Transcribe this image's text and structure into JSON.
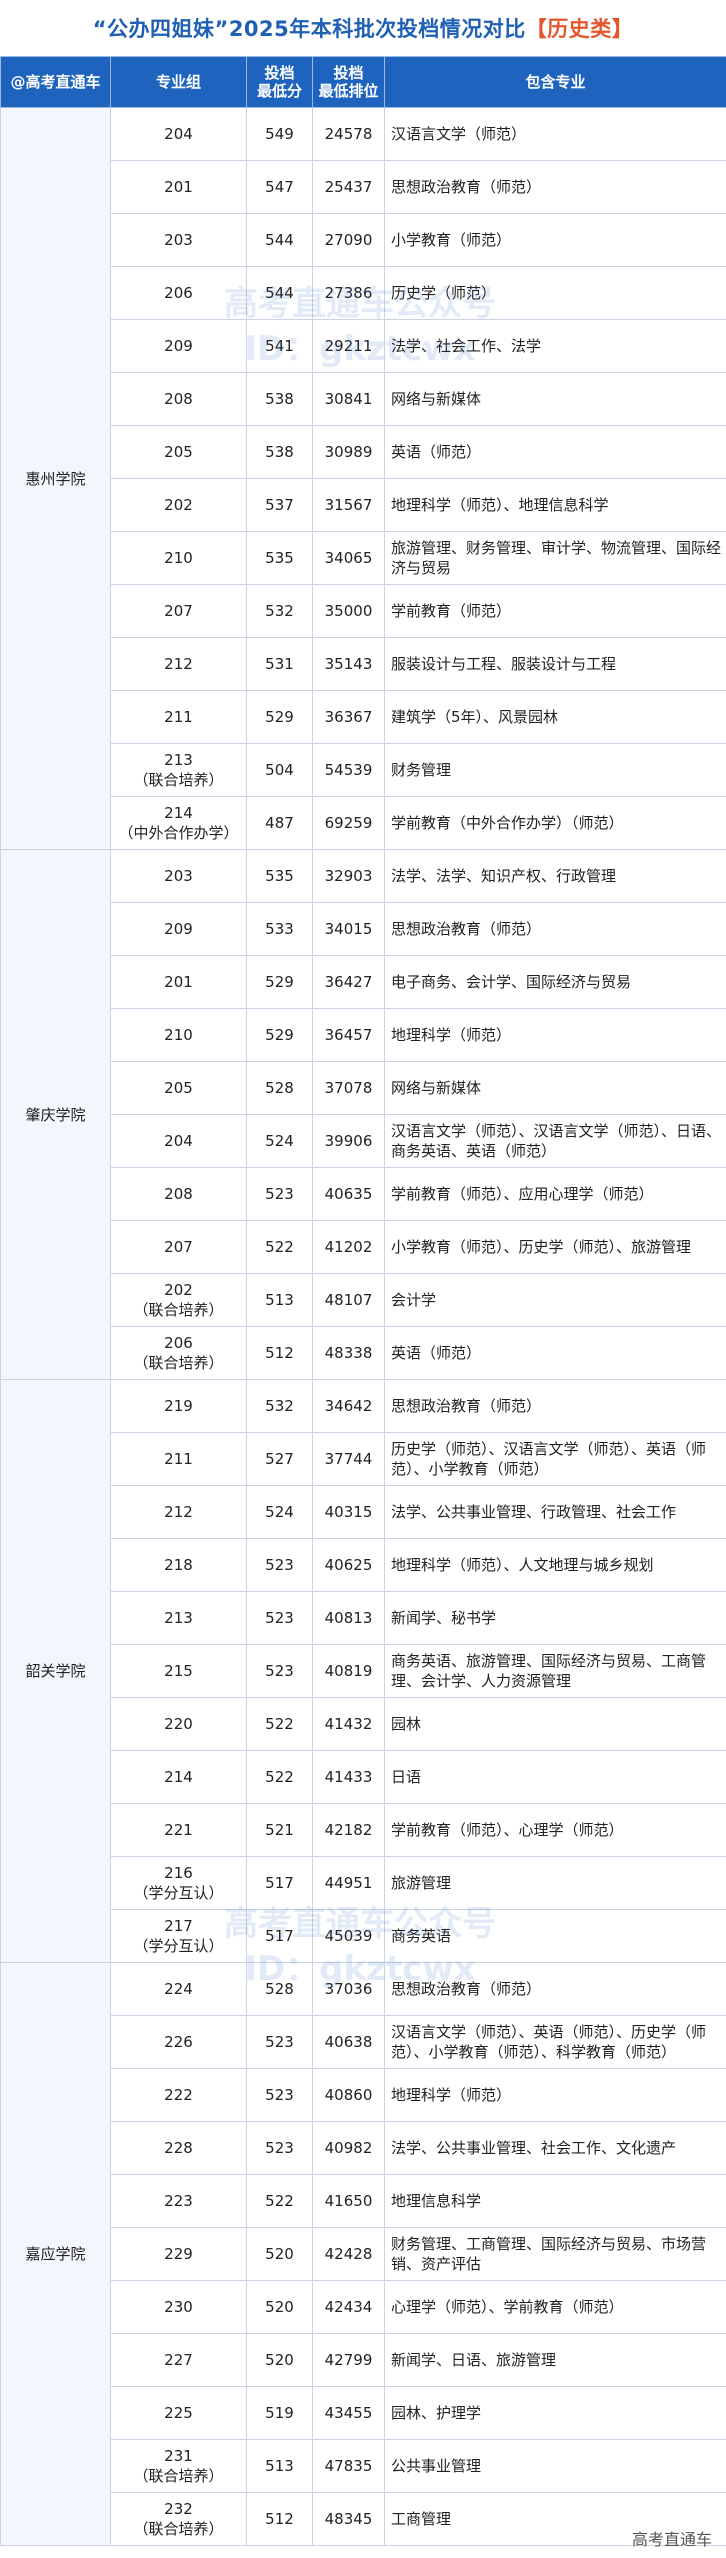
{
  "title": {
    "main": "“公办四姐妹”2025年本科批次投档情况对比",
    "tag": "【历史类】"
  },
  "header": {
    "col1": "@高考直通车",
    "col2": "专业组",
    "col3_line1": "投档",
    "col3_line2": "最低分",
    "col4_line1": "投档",
    "col4_line2": "最低排位",
    "col5": "包含专业"
  },
  "watermark": {
    "text1": "高考直通车公众号",
    "text2": "ID：gkztcwx"
  },
  "footer": "高考直通车",
  "schools": [
    {
      "name": "惠州学院",
      "rows": [
        {
          "group": "204",
          "score": "549",
          "rank": "24578",
          "majors": "汉语言文学（师范）"
        },
        {
          "group": "201",
          "score": "547",
          "rank": "25437",
          "majors": "思想政治教育（师范）"
        },
        {
          "group": "203",
          "score": "544",
          "rank": "27090",
          "majors": "小学教育（师范）"
        },
        {
          "group": "206",
          "score": "544",
          "rank": "27386",
          "majors": "历史学（师范）"
        },
        {
          "group": "209",
          "score": "541",
          "rank": "29211",
          "majors": "法学、社会工作、法学"
        },
        {
          "group": "208",
          "score": "538",
          "rank": "30841",
          "majors": "网络与新媒体"
        },
        {
          "group": "205",
          "score": "538",
          "rank": "30989",
          "majors": "英语（师范）"
        },
        {
          "group": "202",
          "score": "537",
          "rank": "31567",
          "majors": "地理科学（师范）、地理信息科学"
        },
        {
          "group": "210",
          "score": "535",
          "rank": "34065",
          "majors": "旅游管理、财务管理、审计学、物流管理、国际经济与贸易"
        },
        {
          "group": "207",
          "score": "532",
          "rank": "35000",
          "majors": "学前教育（师范）"
        },
        {
          "group": "212",
          "score": "531",
          "rank": "35143",
          "majors": "服装设计与工程、服装设计与工程"
        },
        {
          "group": "211",
          "score": "529",
          "rank": "36367",
          "majors": "建筑学（5年）、风景园林"
        },
        {
          "group": "213",
          "group_note": "（联合培养）",
          "score": "504",
          "rank": "54539",
          "majors": "财务管理"
        },
        {
          "group": "214",
          "group_note": "（中外合作办学）",
          "score": "487",
          "rank": "69259",
          "majors": "学前教育（中外合作办学）（师范）"
        }
      ]
    },
    {
      "name": "肇庆学院",
      "rows": [
        {
          "group": "203",
          "score": "535",
          "rank": "32903",
          "majors": "法学、法学、知识产权、行政管理"
        },
        {
          "group": "209",
          "score": "533",
          "rank": "34015",
          "majors": "思想政治教育（师范）"
        },
        {
          "group": "201",
          "score": "529",
          "rank": "36427",
          "majors": "电子商务、会计学、国际经济与贸易"
        },
        {
          "group": "210",
          "score": "529",
          "rank": "36457",
          "majors": "地理科学（师范）"
        },
        {
          "group": "205",
          "score": "528",
          "rank": "37078",
          "majors": "网络与新媒体"
        },
        {
          "group": "204",
          "score": "524",
          "rank": "39906",
          "majors": "汉语言文学（师范）、汉语言文学（师范）、日语、商务英语、英语（师范）"
        },
        {
          "group": "208",
          "score": "523",
          "rank": "40635",
          "majors": "学前教育（师范）、应用心理学（师范）"
        },
        {
          "group": "207",
          "score": "522",
          "rank": "41202",
          "majors": "小学教育（师范）、历史学（师范）、旅游管理"
        },
        {
          "group": "202",
          "group_note": "（联合培养）",
          "score": "513",
          "rank": "48107",
          "majors": "会计学"
        },
        {
          "group": "206",
          "group_note": "（联合培养）",
          "score": "512",
          "rank": "48338",
          "majors": "英语（师范）"
        }
      ]
    },
    {
      "name": "韶关学院",
      "rows": [
        {
          "group": "219",
          "score": "532",
          "rank": "34642",
          "majors": "思想政治教育（师范）"
        },
        {
          "group": "211",
          "score": "527",
          "rank": "37744",
          "majors": "历史学（师范）、汉语言文学（师范）、英语（师范）、小学教育（师范）"
        },
        {
          "group": "212",
          "score": "524",
          "rank": "40315",
          "majors": "法学、公共事业管理、行政管理、社会工作"
        },
        {
          "group": "218",
          "score": "523",
          "rank": "40625",
          "majors": "地理科学（师范）、人文地理与城乡规划"
        },
        {
          "group": "213",
          "score": "523",
          "rank": "40813",
          "majors": "新闻学、秘书学"
        },
        {
          "group": "215",
          "score": "523",
          "rank": "40819",
          "majors": "商务英语、旅游管理、国际经济与贸易、工商管理、会计学、人力资源管理"
        },
        {
          "group": "220",
          "score": "522",
          "rank": "41432",
          "majors": "园林"
        },
        {
          "group": "214",
          "score": "522",
          "rank": "41433",
          "majors": "日语"
        },
        {
          "group": "221",
          "score": "521",
          "rank": "42182",
          "majors": "学前教育（师范）、心理学（师范）"
        },
        {
          "group": "216",
          "group_note": "（学分互认）",
          "score": "517",
          "rank": "44951",
          "majors": "旅游管理"
        },
        {
          "group": "217",
          "group_note": "（学分互认）",
          "score": "517",
          "rank": "45039",
          "majors": "商务英语"
        }
      ]
    },
    {
      "name": "嘉应学院",
      "rows": [
        {
          "group": "224",
          "score": "528",
          "rank": "37036",
          "majors": "思想政治教育（师范）"
        },
        {
          "group": "226",
          "score": "523",
          "rank": "40638",
          "majors": "汉语言文学（师范）、英语（师范）、历史学（师范）、小学教育（师范）、科学教育（师范）"
        },
        {
          "group": "222",
          "score": "523",
          "rank": "40860",
          "majors": "地理科学（师范）"
        },
        {
          "group": "228",
          "score": "523",
          "rank": "40982",
          "majors": "法学、公共事业管理、社会工作、文化遗产"
        },
        {
          "group": "223",
          "score": "522",
          "rank": "41650",
          "majors": "地理信息科学"
        },
        {
          "group": "229",
          "score": "520",
          "rank": "42428",
          "majors": "财务管理、工商管理、国际经济与贸易、市场营销、资产评估"
        },
        {
          "group": "230",
          "score": "520",
          "rank": "42434",
          "majors": "心理学（师范）、学前教育（师范）"
        },
        {
          "group": "227",
          "score": "520",
          "rank": "42799",
          "majors": "新闻学、日语、旅游管理"
        },
        {
          "group": "225",
          "score": "519",
          "rank": "43455",
          "majors": "园林、护理学"
        },
        {
          "group": "231",
          "group_note": "（联合培养）",
          "score": "513",
          "rank": "47835",
          "majors": "公共事业管理"
        },
        {
          "group": "232",
          "group_note": "（联合培养）",
          "score": "512",
          "rank": "48345",
          "majors": "工商管理"
        }
      ]
    }
  ]
}
